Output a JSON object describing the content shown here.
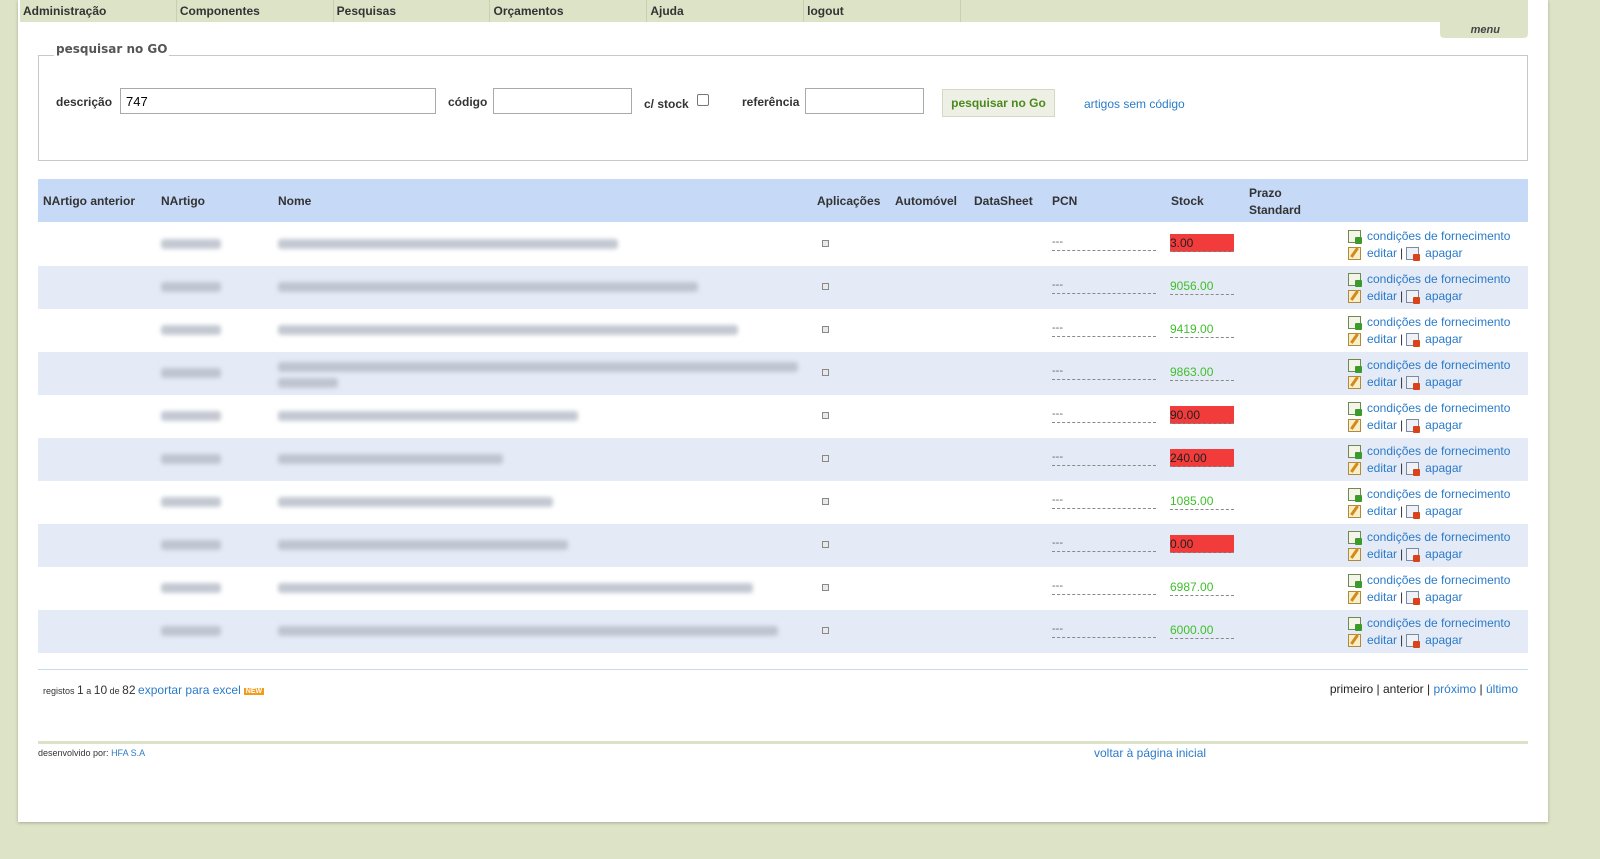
{
  "nav": {
    "items": [
      "Administração",
      "Componentes",
      "Pesquisas",
      "Orçamentos",
      "Ajuda",
      "logout"
    ],
    "menu_label": "menu"
  },
  "search": {
    "legend": "pesquisar no GO",
    "descricao_label": "descrição",
    "descricao_value": "747",
    "codigo_label": "código",
    "codigo_value": "",
    "stock_label": "c/ stock",
    "stock_checked": false,
    "referencia_label": "referência",
    "referencia_value": "",
    "button_label": "pesquisar no Go",
    "artigos_link": "artigos sem código"
  },
  "table": {
    "headers": {
      "nartigo_anterior": "NArtigo anterior",
      "nartigo": "NArtigo",
      "nome": "Nome",
      "aplicacoes": "Aplicações",
      "automovel": "Automóvel",
      "datasheet": "DataSheet",
      "pcn": "PCN",
      "stock": "Stock",
      "prazo": "Prazo Standard"
    },
    "rows": [
      {
        "pcn": "---",
        "stock": "3.00",
        "stock_status": "low"
      },
      {
        "pcn": "---",
        "stock": "9056.00",
        "stock_status": "ok"
      },
      {
        "pcn": "---",
        "stock": "9419.00",
        "stock_status": "ok"
      },
      {
        "pcn": "---",
        "stock": "9863.00",
        "stock_status": "ok"
      },
      {
        "pcn": "---",
        "stock": "90.00",
        "stock_status": "low"
      },
      {
        "pcn": "---",
        "stock": "240.00",
        "stock_status": "low"
      },
      {
        "pcn": "---",
        "stock": "1085.00",
        "stock_status": "ok"
      },
      {
        "pcn": "---",
        "stock": "0.00",
        "stock_status": "low"
      },
      {
        "pcn": "---",
        "stock": "6987.00",
        "stock_status": "ok"
      },
      {
        "pcn": "---",
        "stock": "6000.00",
        "stock_status": "ok"
      }
    ],
    "action_conditions": "condições de fornecimento",
    "action_edit": "editar",
    "action_delete": "apagar",
    "action_sep": "|"
  },
  "footer": {
    "registos_label": "registos",
    "from": "1",
    "a_label": "a",
    "to": "10",
    "de_label": "de",
    "total": "82",
    "export_link": "exportar para excel",
    "new_badge": "NEW",
    "pager": {
      "first": "primeiro",
      "prev": "anterior",
      "next": "próximo",
      "last": "último",
      "sep": "|"
    },
    "dev_label": "desenvolvido por:",
    "dev_company": "HFA S.A",
    "home_link": "voltar à página inicial"
  },
  "colors": {
    "stock_low_bg": "#f23b3b",
    "stock_ok_text": "#3fbf2a",
    "header_bg": "#c6d9f7",
    "row_alt_bg": "#e4eaf6",
    "link": "#2b7bc9",
    "page_bg": "#dde3c7"
  }
}
